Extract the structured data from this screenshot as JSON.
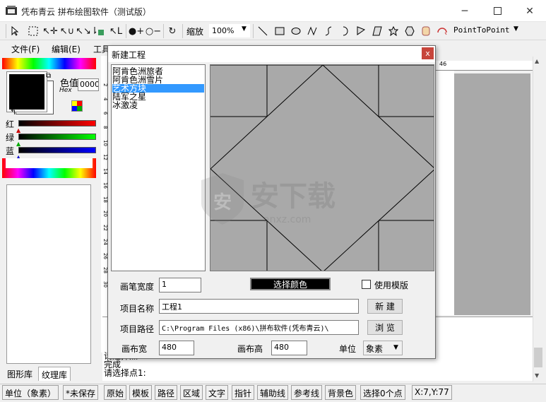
{
  "window": {
    "title": "凭布青云 拼布绘图软件（测试版）",
    "minimize_icon": "minimize-icon",
    "maximize_icon": "maximize-icon",
    "close_icon": "close-icon"
  },
  "toolbar": {
    "zoom_label": "缩放",
    "zoom_value": "100%",
    "mode_value": "PointToPoint"
  },
  "menubar": {
    "items": [
      "文件(F)",
      "编辑(E)",
      "工具"
    ]
  },
  "color_panel": {
    "value_label": "色值",
    "hex_label": "Hex",
    "hex_value": "0000",
    "current_color": "#000000",
    "red_label": "红",
    "green_label": "绿",
    "blue_label": "蓝"
  },
  "left_tabs": [
    "图形库",
    "纹理库"
  ],
  "ruler": {
    "h_number": "46",
    "v_numbers": [
      "2",
      "4",
      "6",
      "8",
      "10",
      "12",
      "14",
      "16",
      "18",
      "20",
      "22",
      "24",
      "26",
      "28",
      "30"
    ]
  },
  "log": {
    "lines": [
      "请选择点1:",
      "完成",
      "请选择点1:"
    ]
  },
  "statusbar": {
    "items": [
      "单位（象素）",
      "*未保存",
      "原始",
      "模板",
      "路径",
      "区域",
      "文字",
      "指针",
      "辅助线",
      "参考线",
      "背景色",
      "选择0个点",
      "X:7,Y:77"
    ]
  },
  "dialog": {
    "title": "新建工程",
    "close_label": "x",
    "projects": [
      "阿肯色洲旅者",
      "阿肯色洲雪片",
      "艺术方块",
      "陆军之星",
      "冰激凌"
    ],
    "selected_index": 2,
    "pen_width_label": "画笔宽度",
    "pen_width_value": "1",
    "color_button": "选择颜色",
    "use_template_label": "使用模版",
    "project_name_label": "项目名称",
    "project_name_value": "工程1",
    "new_button": "新 建",
    "project_path_label": "项目路径",
    "project_path_value": "C:\\Program Files (x86)\\拼布软件(凭布青云)\\",
    "browse_button": "浏 览",
    "canvas_width_label": "画布宽",
    "canvas_width_value": "480",
    "canvas_height_label": "画布高",
    "canvas_height_value": "480",
    "unit_label": "单位",
    "unit_value": "象素"
  },
  "watermark": {
    "text": "安下载",
    "sub": "anxz.com"
  }
}
